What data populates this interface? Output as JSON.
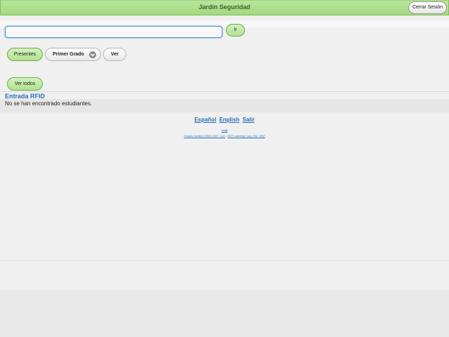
{
  "header": {
    "title": "Jardin Seguridad",
    "logout_label": "Cerrar Sesión"
  },
  "search": {
    "value": "",
    "placeholder": "",
    "go_label": "Ir"
  },
  "filters": {
    "present_label": "Presentes",
    "grade_selected": "Primer Grado",
    "view_label": "Ver"
  },
  "view_all_label": "Ver todos",
  "rfid_link": "Entrada RFID",
  "empty_message": "No se han encontrado estudiantes.",
  "footer": {
    "languages": [
      "Español",
      "English",
      "Salir"
    ],
    "tiny_link": "Lmd",
    "copyright_left": "Grades Garden ©2021 SDT, LLC",
    "copyright_sep": " - ",
    "copyright_right": "SDT Learning Corp. Est. 1997"
  },
  "colors": {
    "header_green": "#a3d97f",
    "link_blue": "#2a6fb5",
    "input_focus": "#4a8fcf"
  },
  "icons": {
    "grade_select": "chevron-down-circle-icon"
  }
}
